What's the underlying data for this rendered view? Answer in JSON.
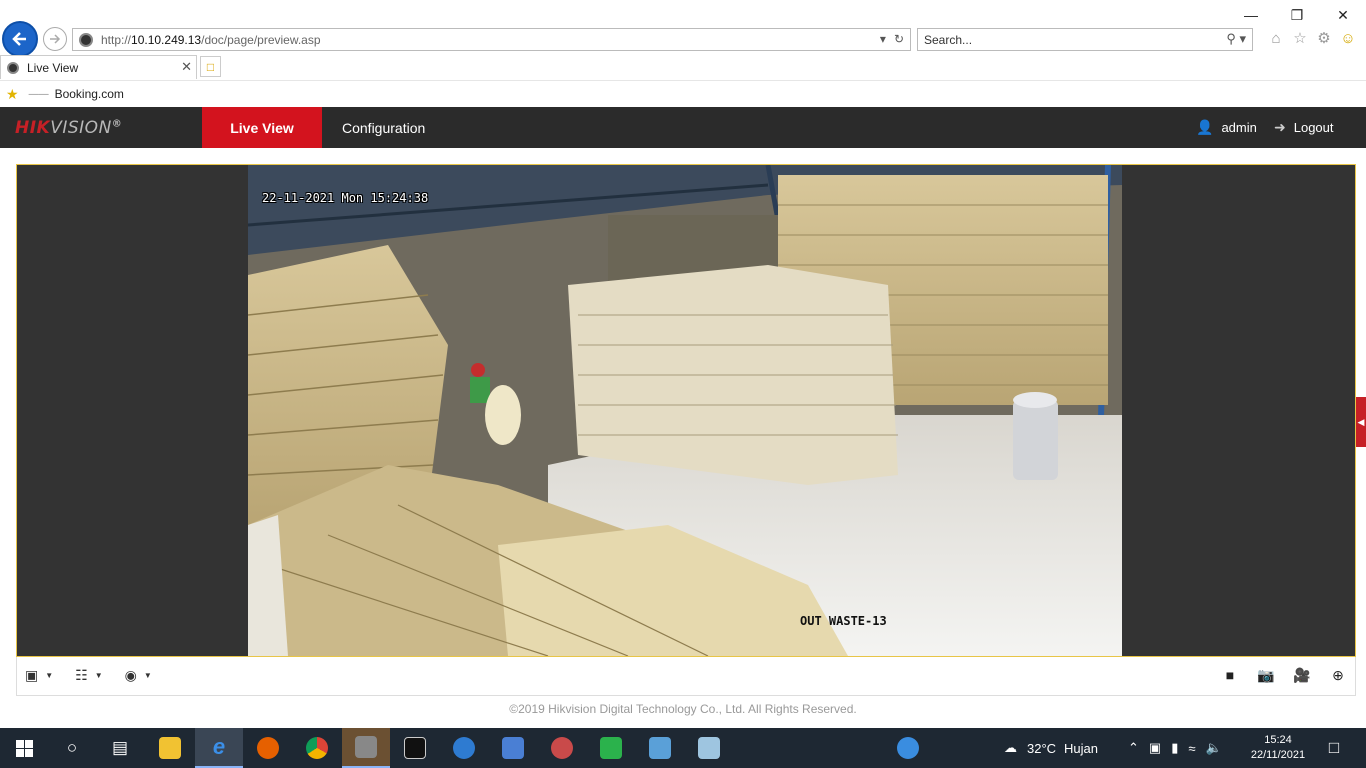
{
  "browser": {
    "url_prefix": "http://",
    "url_host": "10.10.249.13",
    "url_path": "/doc/page/preview.asp",
    "search_placeholder": "Search...",
    "tab_title": "Live View",
    "favorites": [
      {
        "label": "Booking.com"
      }
    ],
    "icons": [
      "back-arrow-icon",
      "forward-arrow-icon",
      "refresh-icon",
      "search-icon",
      "home-icon",
      "star-icon",
      "gear-icon",
      "smiley-icon"
    ]
  },
  "app": {
    "logo_hik": "HIK",
    "logo_vision": "VISION",
    "logo_reg": "®",
    "nav": {
      "live_view": "Live View",
      "configuration": "Configuration"
    },
    "user": "admin",
    "logout": "Logout",
    "accent_color": "#d3131e"
  },
  "video": {
    "osd_datetime": "22-11-2021 Mon 15:24:38",
    "osd_channel": "OUT WASTE-13"
  },
  "toolbar": {
    "left": [
      "window-layout-icon",
      "stream-type-icon",
      "plugin-icon"
    ],
    "right": [
      "stop-all-icon",
      "capture-icon",
      "record-icon",
      "zoom-icon"
    ]
  },
  "footer": {
    "copyright": "©2019 Hikvision Digital Technology Co., Ltd. All Rights Reserved."
  },
  "taskbar": {
    "weather_temp": "32°C",
    "weather_text": "Hujan",
    "time": "15:24",
    "date": "22/11/2021"
  }
}
